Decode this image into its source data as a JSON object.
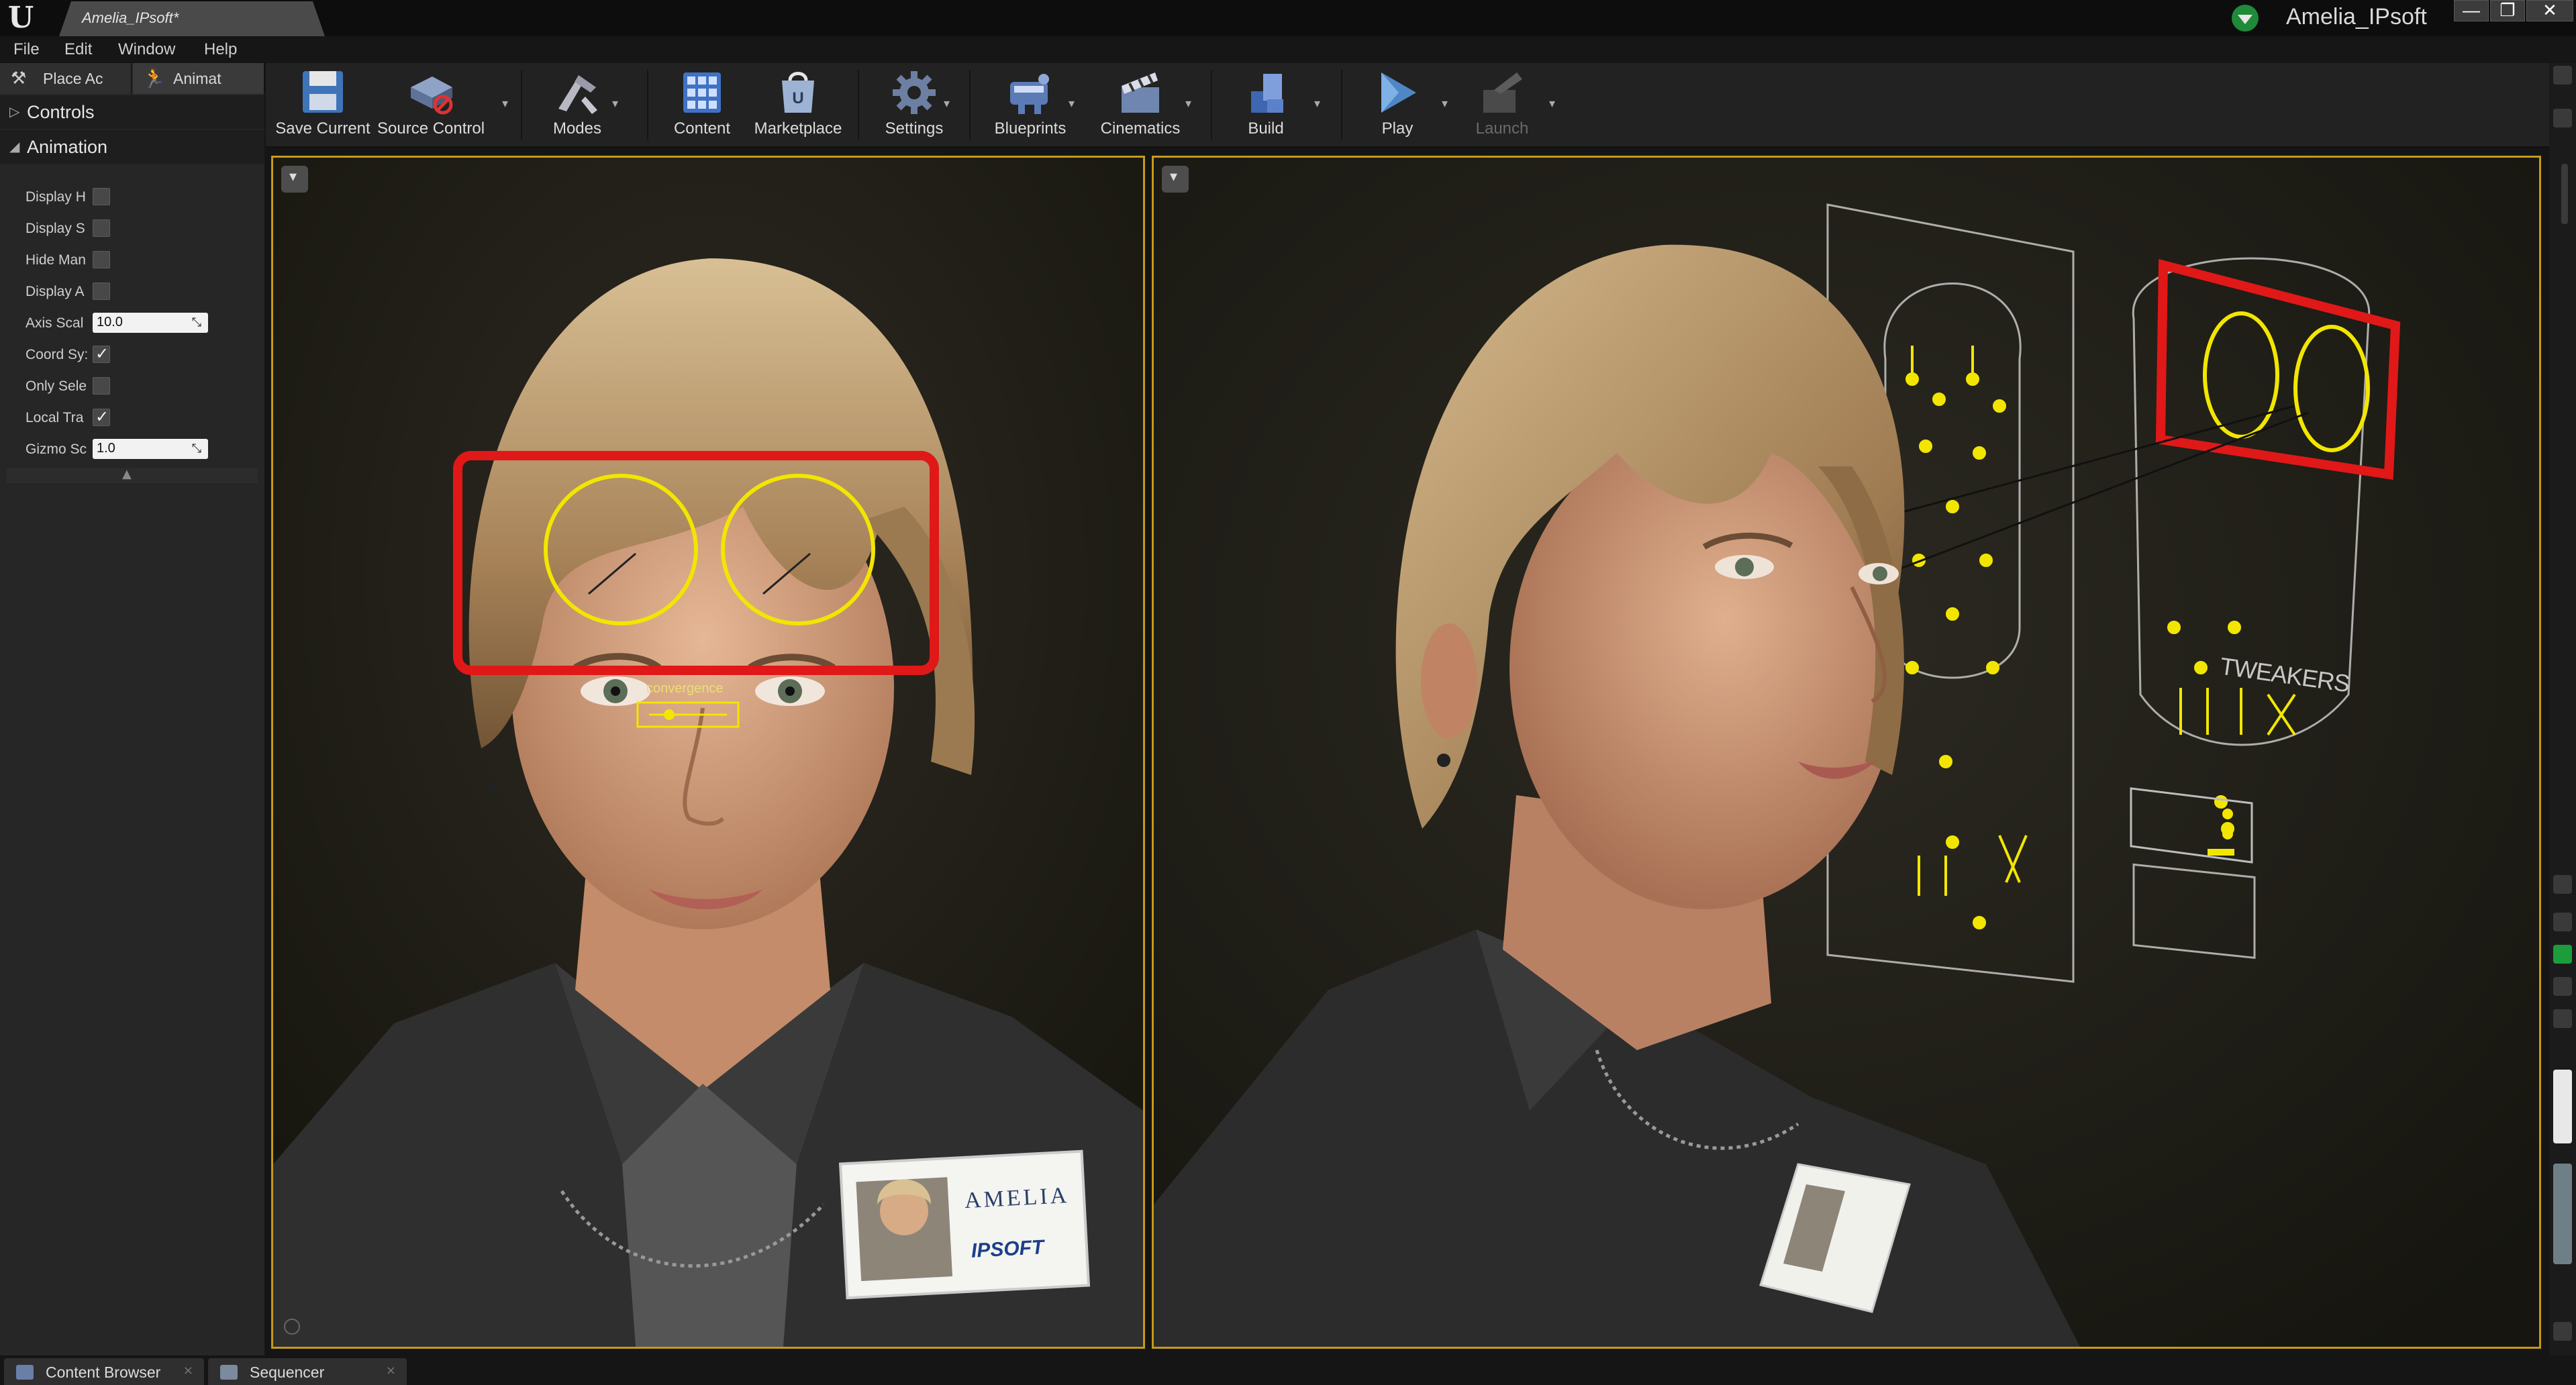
{
  "titlebar": {
    "tab_title": "Amelia_IPsoft*",
    "project_name": "Amelia_IPsoft",
    "app_logo": "unreal-engine-logo",
    "window_buttons": [
      "—",
      "❐",
      "✕"
    ]
  },
  "menu": [
    "File",
    "Edit",
    "Window",
    "Help"
  ],
  "mode_tabs": [
    "Place Ac",
    "Animat"
  ],
  "left_panel": {
    "sections": [
      "Controls",
      "Animation"
    ],
    "properties": [
      {
        "label": "Display H",
        "type": "checkbox",
        "checked": false
      },
      {
        "label": "Display S",
        "type": "checkbox",
        "checked": false
      },
      {
        "label": "Hide Man",
        "type": "checkbox",
        "checked": false
      },
      {
        "label": "Display A",
        "type": "checkbox",
        "checked": false
      },
      {
        "label": "Axis Scal",
        "type": "number",
        "value": "10.0"
      },
      {
        "label": "Coord Sy:",
        "type": "checkbox",
        "checked": true
      },
      {
        "label": "Only Sele",
        "type": "checkbox",
        "checked": false
      },
      {
        "label": "Local Tra",
        "type": "checkbox",
        "checked": true
      },
      {
        "label": "Gizmo Sc",
        "type": "number",
        "value": "1.0"
      }
    ]
  },
  "toolbar": {
    "buttons": [
      {
        "label": "Save Current",
        "icon": "save-icon",
        "color": "#3a6fb0"
      },
      {
        "label": "Source Control",
        "icon": "source-control-icon",
        "color": "#6c7ea0"
      },
      {
        "label": "Modes",
        "icon": "modes-icon",
        "color": "#9a9aa8"
      },
      {
        "label": "Content",
        "icon": "content-icon",
        "color": "#3f72c4"
      },
      {
        "label": "Marketplace",
        "icon": "marketplace-icon",
        "color": "#8aa4c8"
      },
      {
        "label": "Settings",
        "icon": "settings-icon",
        "color": "#6d7fa2"
      },
      {
        "label": "Blueprints",
        "icon": "blueprints-icon",
        "color": "#5b7bb7"
      },
      {
        "label": "Cinematics",
        "icon": "cinematics-icon",
        "color": "#6f86b0"
      },
      {
        "label": "Build",
        "icon": "build-icon",
        "color": "#4e78c8"
      },
      {
        "label": "Play",
        "icon": "play-icon",
        "color": "#4f86c6"
      },
      {
        "label": "Launch",
        "icon": "launch-icon",
        "color": "#5a5a5a"
      }
    ]
  },
  "viewports": {
    "left_overlay_label": "convergence",
    "badge_name": "AMELIA",
    "badge_company": "IPSOFT",
    "right_panel_label": "TWEAKERS"
  },
  "bottom_tabs": [
    "Content Browser",
    "Sequencer"
  ],
  "colors": {
    "accent": "#c59a18",
    "highlight_red": "#e01818",
    "rig_yellow": "#f2e600",
    "background": "#262626"
  }
}
